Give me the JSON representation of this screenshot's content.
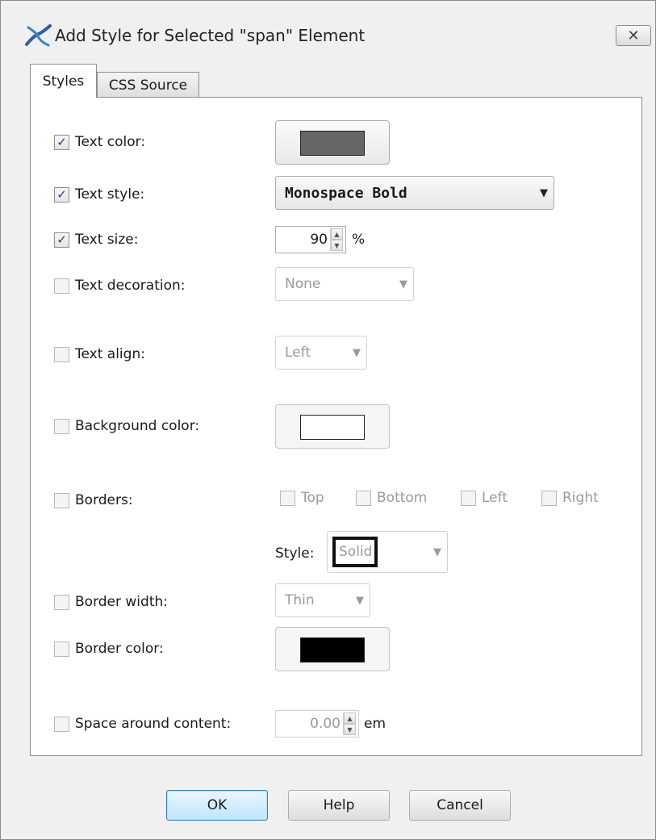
{
  "window": {
    "title": "Add Style for Selected \"span\" Element",
    "close_glyph": "✕"
  },
  "tabs": [
    {
      "label": "Styles",
      "active": true
    },
    {
      "label": "CSS Source",
      "active": false
    }
  ],
  "fields": {
    "text_color": {
      "label": "Text color:",
      "checked": true,
      "swatch": "#666666"
    },
    "text_style": {
      "label": "Text style:",
      "checked": true,
      "value": "Monospace Bold"
    },
    "text_size": {
      "label": "Text size:",
      "checked": true,
      "value": "90",
      "unit": "%"
    },
    "text_decoration": {
      "label": "Text decoration:",
      "checked": false,
      "value": "None"
    },
    "text_align": {
      "label": "Text align:",
      "checked": false,
      "value": "Left"
    },
    "background_color": {
      "label": "Background color:",
      "checked": false,
      "swatch": "#ffffff"
    },
    "borders": {
      "label": "Borders:",
      "checked": false,
      "options": [
        "Top",
        "Bottom",
        "Left",
        "Right"
      ],
      "style_label": "Style:",
      "style_value": "Solid"
    },
    "border_width": {
      "label": "Border width:",
      "checked": false,
      "value": "Thin"
    },
    "border_color": {
      "label": "Border color:",
      "checked": false,
      "swatch": "#000000"
    },
    "space_around": {
      "label": "Space around content:",
      "checked": false,
      "value": "0.00",
      "unit": "em"
    }
  },
  "buttons": {
    "ok": "OK",
    "help": "Help",
    "cancel": "Cancel"
  },
  "check_glyph": "✓"
}
